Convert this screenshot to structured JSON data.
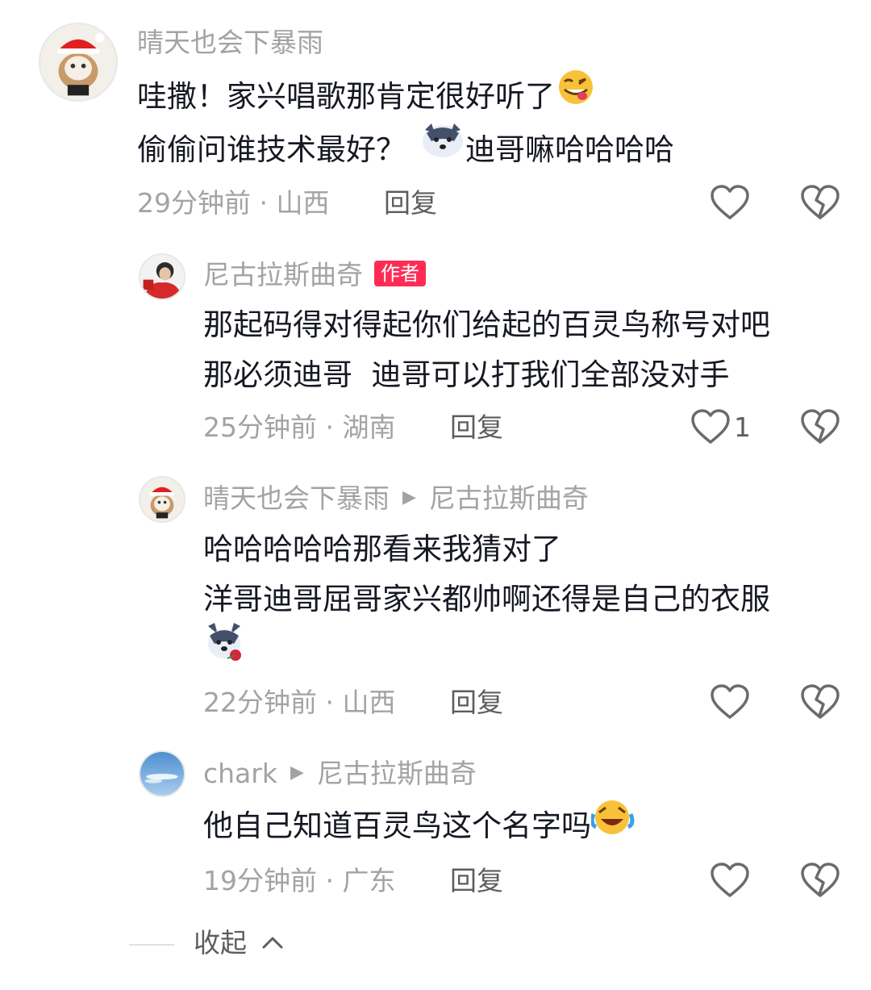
{
  "comments": [
    {
      "username": "晴天也会下暴雨",
      "lines": [
        "哇撒！家兴唱歌那肯定很好听了",
        "偷偷问谁技术最好？",
        "迪哥嘛哈哈哈哈"
      ],
      "time": "29分钟前",
      "location": "山西",
      "reply_label": "回复"
    },
    {
      "username": "尼古拉斯曲奇",
      "badge": "作者",
      "lines": [
        "那起码得对得起你们给起的百灵鸟称号对吧",
        "那必须迪哥  迪哥可以打我们全部没对手"
      ],
      "time": "25分钟前",
      "location": "湖南",
      "reply_label": "回复",
      "likes": "1"
    },
    {
      "username": "晴天也会下暴雨",
      "reply_to": "尼古拉斯曲奇",
      "lines": [
        "哈哈哈哈哈那看来我猜对了",
        "洋哥迪哥屈哥家兴都帅啊还得是自己的衣服"
      ],
      "time": "22分钟前",
      "location": "山西",
      "reply_label": "回复"
    },
    {
      "username": "chark",
      "reply_to": "尼古拉斯曲奇",
      "lines": [
        "他自己知道百灵鸟这个名字吗"
      ],
      "time": "19分钟前",
      "location": "广东",
      "reply_label": "回复"
    }
  ],
  "separator": " · ",
  "collapse_label": "收起",
  "icons": {
    "like": "heart-outline-icon",
    "dislike": "broken-heart-icon",
    "emoji_grin": "grinning-tongue-emoji",
    "emoji_husky": "husky-emoji",
    "emoji_laugh": "rofl-emoji",
    "reply_arrow": "triangle-right-icon",
    "collapse": "chevron-up-icon"
  },
  "colors": {
    "author_badge": "#fe2c55",
    "primary_text": "#161823",
    "secondary_text": "#a3a3a3"
  }
}
